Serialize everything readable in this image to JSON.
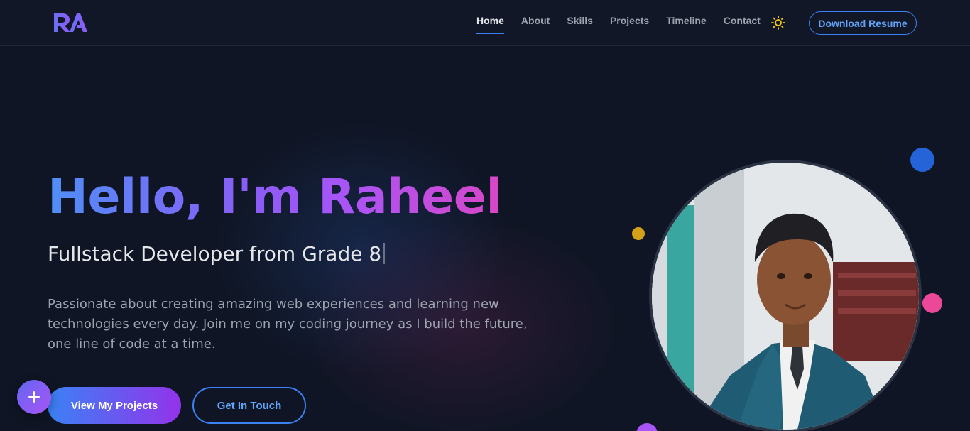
{
  "brand": {
    "logo_text": "RA"
  },
  "nav": {
    "links": [
      "Home",
      "About",
      "Skills",
      "Projects",
      "Timeline",
      "Contact"
    ],
    "active": "Home",
    "resume_label": "Download Resume"
  },
  "hero": {
    "title": "Hello, I'm Raheel",
    "subtitle": "Fullstack Developer from Grade 8",
    "description": "Passionate about creating amazing web experiences and learning new technologies every day. Join me on my coding journey as I build the future, one line of code at a time.",
    "primary_cta": "View My Projects",
    "secondary_cta": "Get In Touch"
  },
  "icons": {
    "theme_toggle": "sun-icon",
    "fab": "plus-icon"
  },
  "colors": {
    "background": "#0f1524",
    "accent_blue": "#3b82f6",
    "accent_purple": "#9333ea",
    "accent_pink": "#ec4899",
    "accent_gold": "#d4a017"
  }
}
